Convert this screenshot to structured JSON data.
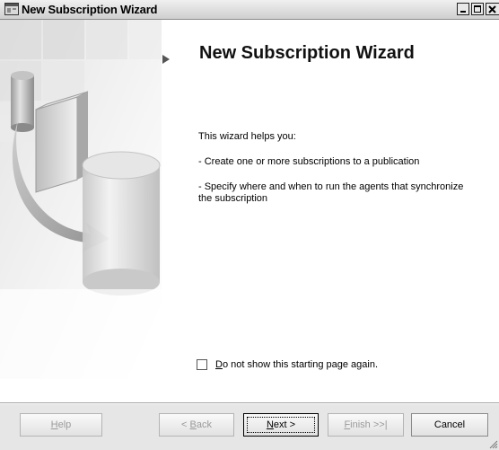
{
  "window": {
    "title": "New Subscription Wizard"
  },
  "page": {
    "heading": "New Subscription Wizard",
    "intro": "This wizard helps you:",
    "bullets": [
      "- Create one or more subscriptions to a publication",
      "- Specify where and when to run the agents that synchronize the subscription"
    ]
  },
  "checkbox": {
    "label_mnemonic": "D",
    "label_rest": "o not show this starting page again.",
    "checked": false
  },
  "buttons": {
    "help": {
      "mnemonic": "H",
      "rest": "elp"
    },
    "back": {
      "prefix": "< ",
      "mnemonic": "B",
      "rest": "ack"
    },
    "next": {
      "mnemonic": "N",
      "rest": "ext >"
    },
    "finish": {
      "mnemonic": "F",
      "rest": "inish >>|"
    },
    "cancel": "Cancel"
  },
  "icons": {
    "window_icon": "wizard-window-icon",
    "minimize": "minimize-icon",
    "maximize": "maximize-icon",
    "close": "close-icon",
    "step_marker": "triangle-right-icon",
    "resize_grip": "resize-grip-icon"
  },
  "colors": {
    "title_bar": "#cfcfcf",
    "button_bar": "#e6e6e6",
    "disabled_text": "#9a9a9a"
  }
}
